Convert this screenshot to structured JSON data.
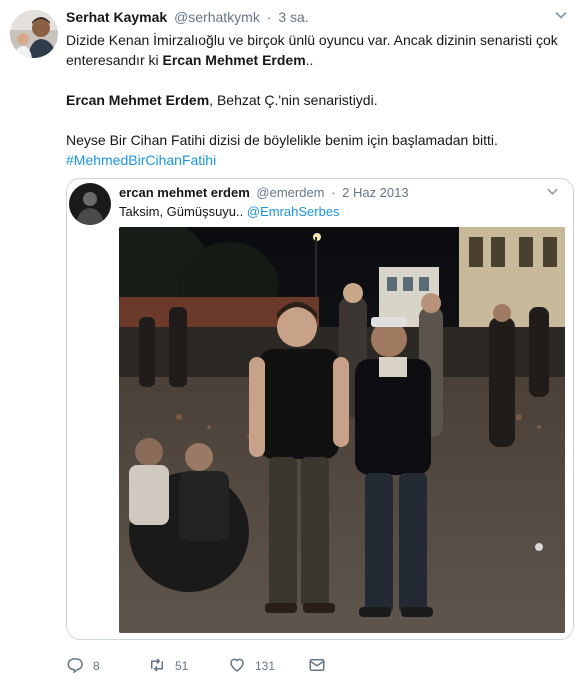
{
  "author": {
    "name": "Serhat Kaymak",
    "handle": "@serhatkymk",
    "separator": "·",
    "time": "3 sa."
  },
  "body": {
    "line1_prefix": "Dizide Kenan İmirzalıoğlu ve birçok ünlü oyuncu var. Ancak dizinin senaristi çok enteresandır ki ",
    "line1_bold": "Ercan Mehmet Erdem",
    "line1_suffix": "..",
    "line2_bold": "Ercan Mehmet Erdem",
    "line2_suffix": ", Behzat Ç.'nin senaristiydi.",
    "line3": "Neyse Bir Cihan Fatihi dizisi de böylelikle benim için başlamadan bitti.",
    "hashtag": "#MehmedBirCihanFatihi"
  },
  "quoted": {
    "name": "ercan mehmet erdem",
    "handle": "@emerdem",
    "separator": "·",
    "date": "2 Haz 2013",
    "text": "Taksim, Gümüşsuyu.. ",
    "mention": "@EmrahSerbes"
  },
  "actions": {
    "reply_count": "8",
    "retweet_count": "51",
    "like_count": "131"
  },
  "colors": {
    "link": "#1b95e0",
    "muted": "#657786",
    "border": "#ccd6dd"
  },
  "icons": [
    "chevron-down-icon",
    "reply-icon",
    "retweet-icon",
    "like-icon",
    "direct-message-icon"
  ]
}
